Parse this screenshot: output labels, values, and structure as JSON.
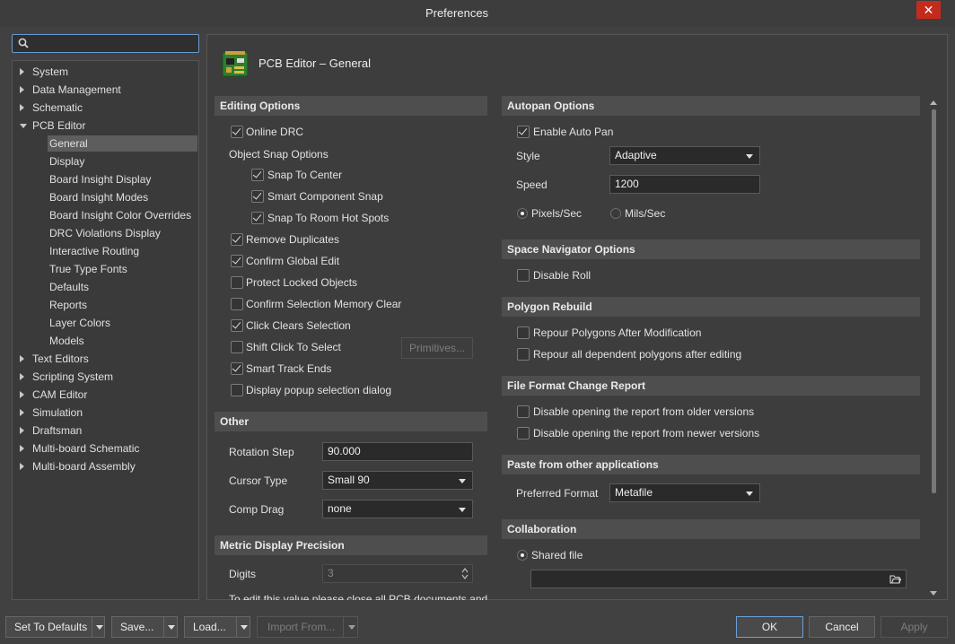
{
  "window": {
    "title": "Preferences"
  },
  "search": {
    "placeholder": ""
  },
  "tree": {
    "items": [
      {
        "label": "System",
        "level": 0,
        "expanded": false
      },
      {
        "label": "Data Management",
        "level": 0,
        "expanded": false
      },
      {
        "label": "Schematic",
        "level": 0,
        "expanded": false
      },
      {
        "label": "PCB Editor",
        "level": 0,
        "expanded": true
      },
      {
        "label": "General",
        "level": 1,
        "selected": true
      },
      {
        "label": "Display",
        "level": 1
      },
      {
        "label": "Board Insight Display",
        "level": 1
      },
      {
        "label": "Board Insight Modes",
        "level": 1
      },
      {
        "label": "Board Insight Color Overrides",
        "level": 1
      },
      {
        "label": "DRC Violations Display",
        "level": 1
      },
      {
        "label": "Interactive Routing",
        "level": 1
      },
      {
        "label": "True Type Fonts",
        "level": 1
      },
      {
        "label": "Defaults",
        "level": 1
      },
      {
        "label": "Reports",
        "level": 1
      },
      {
        "label": "Layer Colors",
        "level": 1
      },
      {
        "label": "Models",
        "level": 1
      },
      {
        "label": "Text Editors",
        "level": 0,
        "expanded": false
      },
      {
        "label": "Scripting System",
        "level": 0,
        "expanded": false
      },
      {
        "label": "CAM Editor",
        "level": 0,
        "expanded": false
      },
      {
        "label": "Simulation",
        "level": 0,
        "expanded": false
      },
      {
        "label": "Draftsman",
        "level": 0,
        "expanded": false
      },
      {
        "label": "Multi-board Schematic",
        "level": 0,
        "expanded": false
      },
      {
        "label": "Multi-board Assembly",
        "level": 0,
        "expanded": false
      }
    ]
  },
  "page": {
    "title": "PCB Editor – General",
    "icon": "pcb-board-icon"
  },
  "editing": {
    "header": "Editing Options",
    "online_drc": "Online DRC",
    "object_snap": "Object Snap Options",
    "snap_center": "Snap To Center",
    "smart_component_snap": "Smart Component Snap",
    "snap_room": "Snap To Room Hot Spots",
    "remove_duplicates": "Remove Duplicates",
    "confirm_global_edit": "Confirm Global Edit",
    "protect_locked": "Protect Locked Objects",
    "confirm_selection_memory": "Confirm Selection Memory Clear",
    "click_clears": "Click Clears Selection",
    "shift_click": "Shift Click To Select",
    "primitives_button": "Primitives...",
    "smart_track_ends": "Smart Track Ends",
    "display_popup": "Display popup selection dialog"
  },
  "other": {
    "header": "Other",
    "rotation_label": "Rotation Step",
    "rotation_value": "90.000",
    "cursor_label": "Cursor Type",
    "cursor_value": "Small 90",
    "comp_drag_label": "Comp Drag",
    "comp_drag_value": "none"
  },
  "metric": {
    "header": "Metric Display Precision",
    "digits_label": "Digits",
    "digits_value": "3",
    "note": "To edit this value please close all PCB documents and"
  },
  "autopan": {
    "header": "Autopan Options",
    "enable": "Enable Auto Pan",
    "style_label": "Style",
    "style_value": "Adaptive",
    "speed_label": "Speed",
    "speed_value": "1200",
    "pixels": "Pixels/Sec",
    "mils": "Mils/Sec"
  },
  "space_nav": {
    "header": "Space Navigator Options",
    "disable_roll": "Disable Roll"
  },
  "polygon": {
    "header": "Polygon Rebuild",
    "repour_after": "Repour Polygons After Modification",
    "repour_dependent": "Repour all dependent polygons after editing"
  },
  "file_format": {
    "header": "File Format Change Report",
    "older": "Disable opening the report from older versions",
    "newer": "Disable opening the report from newer versions"
  },
  "paste": {
    "header": "Paste from other applications",
    "preferred_label": "Preferred Format",
    "preferred_value": "Metafile"
  },
  "collab": {
    "header": "Collaboration",
    "shared_file": "Shared file",
    "path_value": ""
  },
  "footer": {
    "set_defaults": "Set To Defaults",
    "save": "Save...",
    "load": "Load...",
    "import_from": "Import From...",
    "ok": "OK",
    "cancel": "Cancel",
    "apply": "Apply"
  },
  "colors": {
    "accent": "#6b9fd6",
    "close": "#c42b1c",
    "selection": "#5d5d5d"
  }
}
